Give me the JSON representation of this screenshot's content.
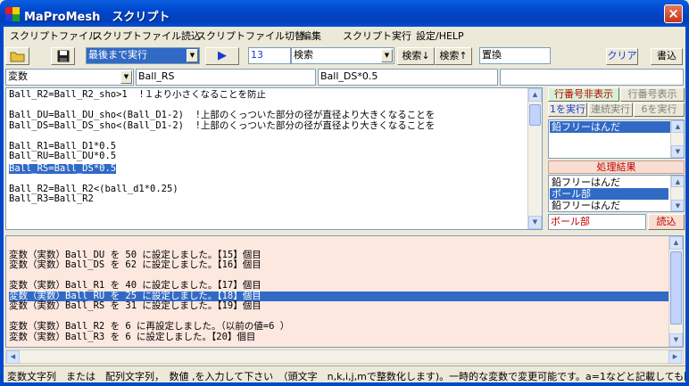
{
  "window": {
    "title": "MaProMesh　スクリプト",
    "close": "×"
  },
  "menu": [
    "スクリプトファイル",
    "スクリプトファイル読込",
    "スクリプトファイル切替",
    "編集",
    "スクリプト実行",
    "設定/HELP"
  ],
  "toolbar": {
    "run_mode": "最後まで実行",
    "run_icon": "▶",
    "line_no": "13",
    "search_value": "検索",
    "search_down": "検索↓",
    "search_up": "検索↑",
    "replace": "置換",
    "clear": "クリア",
    "write": "書込"
  },
  "var_row": {
    "type": "変数",
    "name": "Ball_RS",
    "value": "Ball_DS*0.5",
    "extra": ""
  },
  "editor": {
    "lines": [
      "Ball_R2=Ball_R2_sho>1  !１より小さくなることを防止",
      "",
      "Ball_DU=Ball_DU_sho<(Ball_D1-2)  !上部のくっついた部分の径が直径より大きくなることを",
      "Ball_DS=Ball_DS_sho<(Ball_D1-2)  !上部のくっついた部分の径が直径より大きくなることを",
      "",
      "Ball_R1=Ball_D1*0.5",
      "Ball_RU=Ball_DU*0.5",
      "Ball_RS=Ball_DS*0.5",
      "",
      "Ball_R2=Ball_R2<(ball_d1*0.25)",
      "Ball_R3=Ball_R2"
    ],
    "selected_index": 7
  },
  "side": {
    "hide_line_no": "行番号非表示",
    "show_line_no": "行番号表示",
    "run_one": "1を実行",
    "run_cont": "連続実行",
    "run_six": "6を実行",
    "list1": [
      "鉛フリーはんだ"
    ],
    "results_label": "処理結果",
    "results": [
      "鉛フリーはんだ",
      "ボール部",
      "鉛フリーはんだ"
    ],
    "results_selected": 1,
    "result_field": "ボール部",
    "load": "読込"
  },
  "log": {
    "lines": [
      "",
      "変数（実数）Ball_DU を 50 に設定しました。【15】個目",
      "変数（実数）Ball_DS を 62 に設定しました。【16】個目",
      "",
      "変数（実数）Ball_R1 を 40 に設定しました。【17】個目",
      "変数（実数）Ball_RU を 25 に設定しました。【18】個目",
      "変数（実数）Ball_RS を 31 に設定しました。【19】個目",
      "",
      "変数（実数）Ball_R2 を 6 に再設定しました。（以前の値=6 ）",
      "変数（実数）Ball_R3 を 6 に設定しました。【20】個目"
    ],
    "selected_index": 5
  },
  "status": "変数文字列　または　配列文字列，　数値 ,を入力して下さい　（頭文字　n,k,i,j,mで整数化します)。一時的な変数で変更可能です。a=1などと記載しても同"
}
